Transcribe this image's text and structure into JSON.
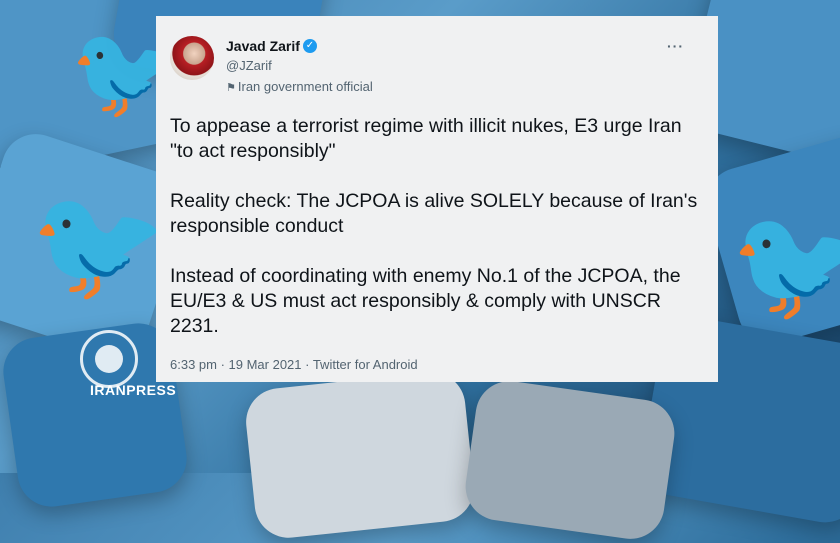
{
  "tweet": {
    "author_name": "Javad Zarif",
    "handle": "@JZarif",
    "label": "Iran government official",
    "paragraphs": [
      "To appease a terrorist regime with illicit nukes, E3 urge Iran \"to act responsibly\"",
      "Reality check: The JCPOA is alive SOLELY because of Iran's responsible conduct",
      "Instead of coordinating with enemy No.1 of the JCPOA, the EU/E3 & US must act responsibly & comply with UNSCR 2231."
    ],
    "timestamp": "6:33 pm · 19 Mar 2021 · Twitter for Android"
  },
  "watermark": {
    "text": "IRANPRESS"
  },
  "icons": {
    "verified": "verified-badge-icon",
    "label": "flag-icon",
    "more": "more-options-icon",
    "background": "twitter-bird-icon"
  },
  "colors": {
    "card_bg": "#f0f1f2",
    "text_primary": "#0f1419",
    "text_secondary": "#536471",
    "verified_blue": "#1d9bf0",
    "twitter_blue": "#4a9bd4"
  }
}
